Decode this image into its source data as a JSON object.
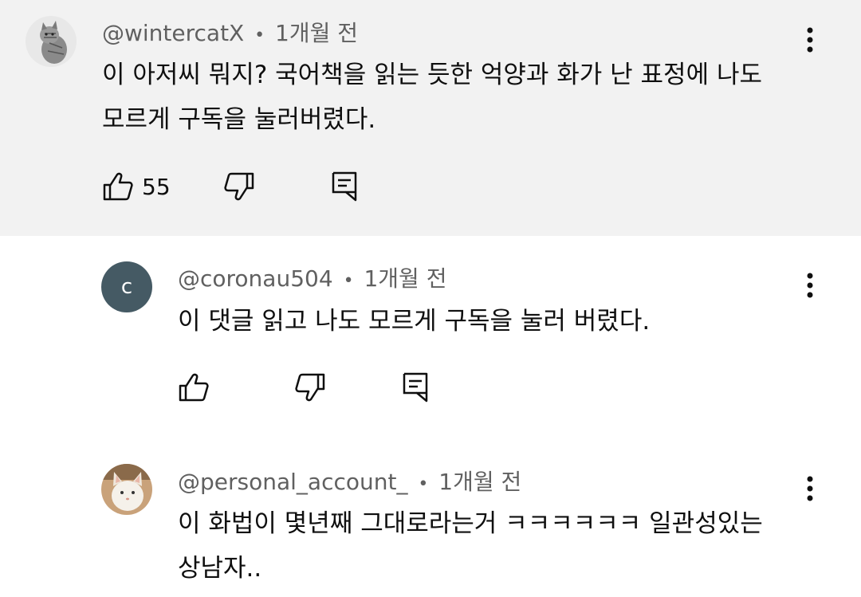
{
  "comments": [
    {
      "author": "@wintercatX",
      "separator": "•",
      "time": "1개월 전",
      "lines": [
        "이 아저씨 뭐지? 국어책을 읽는 듯한 억양과 화가 난 표정에 나도",
        "모르게 구독을 눌러버렸다."
      ],
      "likes": "55",
      "avatar": "cat-photo-grey-tabby",
      "highlighted": true
    },
    {
      "author": "@coronau504",
      "separator": "•",
      "time": "1개월 전",
      "lines": [
        "이 댓글 읽고 나도 모르게 구독을 눌러 버렸다."
      ],
      "likes": "",
      "avatar_letter": "c",
      "avatar_color": "#455a64"
    },
    {
      "author": "@personal_account_",
      "separator": "•",
      "time": "1개월 전",
      "lines": [
        "이 화법이 몇년째 그대로라는거 ㅋㅋㅋㅋㅋㅋ 일관성있는",
        "상남자.."
      ],
      "likes": "",
      "avatar": "cat-photo-white-cream"
    }
  ],
  "colors": {
    "highlight_bg": "#f2f2f2",
    "meta_text": "#606060",
    "body_text": "#0f0f0f"
  }
}
